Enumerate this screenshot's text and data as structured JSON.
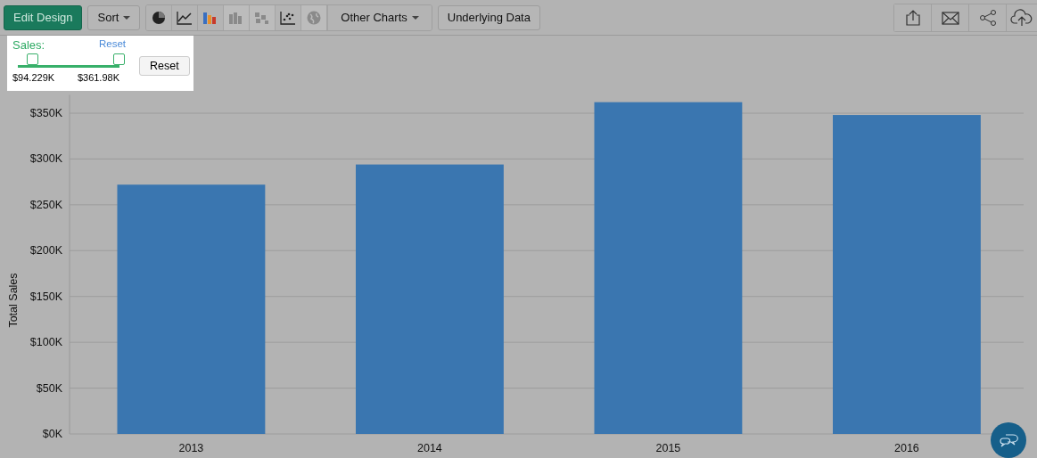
{
  "toolbar": {
    "edit_button": "Edit Design",
    "sort_button": "Sort",
    "chart_types": [
      {
        "kind": "pie",
        "disabled": false
      },
      {
        "kind": "line",
        "disabled": false
      },
      {
        "kind": "bar",
        "disabled": false
      },
      {
        "kind": "stacked",
        "disabled": true
      },
      {
        "kind": "heatmap",
        "disabled": true
      },
      {
        "kind": "scatter",
        "disabled": false
      },
      {
        "kind": "globe",
        "disabled": true
      }
    ],
    "other_charts": "Other Charts",
    "underlying_data": "Underlying Data"
  },
  "filter": {
    "label": "Sales:",
    "reset_link": "Reset",
    "low": {
      "level": 0.14,
      "reading": "$94.229K"
    },
    "high": {
      "level": 1,
      "reading": "$361.98K"
    },
    "reset_button": "Reset"
  },
  "chart": {
    "chart_data": {
      "type": "bar",
      "ylabel": "Total Sales",
      "categories": [
        "2013",
        "2014",
        "2015",
        "2016"
      ],
      "series": [
        {
          "color": "#3a76b0",
          "values": [
            272000,
            294000,
            362000,
            348000
          ]
        }
      ],
      "ylim": [
        0,
        370000
      ],
      "grid": true,
      "yticks": [
        {
          "value": 0,
          "label": "$0K"
        },
        {
          "value": 50000,
          "label": "$50K"
        },
        {
          "value": 100000,
          "label": "$100K"
        },
        {
          "value": 150000,
          "label": "$150K"
        },
        {
          "value": 200000,
          "label": "$200K"
        },
        {
          "value": 250000,
          "label": "$250K"
        },
        {
          "value": 300000,
          "label": "$300K"
        },
        {
          "value": 350000,
          "label": "$350K"
        }
      ]
    }
  }
}
